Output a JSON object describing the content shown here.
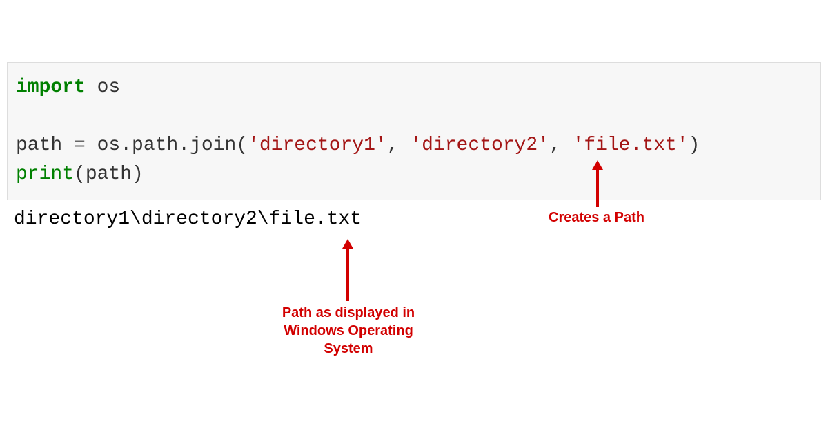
{
  "code": {
    "line1_keyword": "import",
    "line1_module": " os",
    "line2": "",
    "line3_var": "path ",
    "line3_eq": "=",
    "line3_call": " os.path.join(",
    "line3_str1": "'directory1'",
    "line3_comma1": ", ",
    "line3_str2": "'directory2'",
    "line3_comma2": ", ",
    "line3_str3": "'file.txt'",
    "line3_close": ")",
    "line4_print": "print",
    "line4_open": "(path)"
  },
  "output": "directory1\\directory2\\file.txt",
  "annotations": {
    "creates_path": "Creates a Path",
    "windows_path": "Path as displayed in Windows Operating System"
  }
}
